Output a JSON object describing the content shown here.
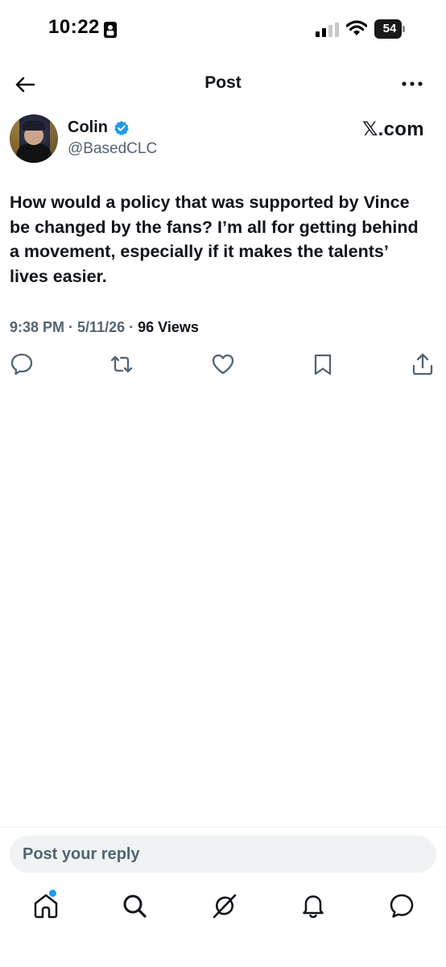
{
  "status_bar": {
    "time": "10:22",
    "battery": "54"
  },
  "header": {
    "title": "Post"
  },
  "author": {
    "name": "Colin",
    "handle": "@BasedCLC"
  },
  "source": "𝕏.com",
  "post": {
    "text": "How would a policy that was supported by Vince be changed by the fans? I’m all for getting behind a movement, especially if it makes the talents’ lives easier.",
    "time": "9:38 PM",
    "date": "5/11/26",
    "views_count": "96",
    "views_label": "Views"
  },
  "actions": [
    "reply-icon",
    "repost-icon",
    "like-icon",
    "bookmark-icon",
    "share-icon"
  ],
  "reply": {
    "placeholder": "Post your reply"
  },
  "tab_bar": [
    "home-icon",
    "search-icon",
    "grok-icon",
    "notifications-icon",
    "messages-icon"
  ],
  "colors": {
    "accent": "#1d9bf0",
    "text": "#0f1419",
    "secondary": "#536471"
  }
}
